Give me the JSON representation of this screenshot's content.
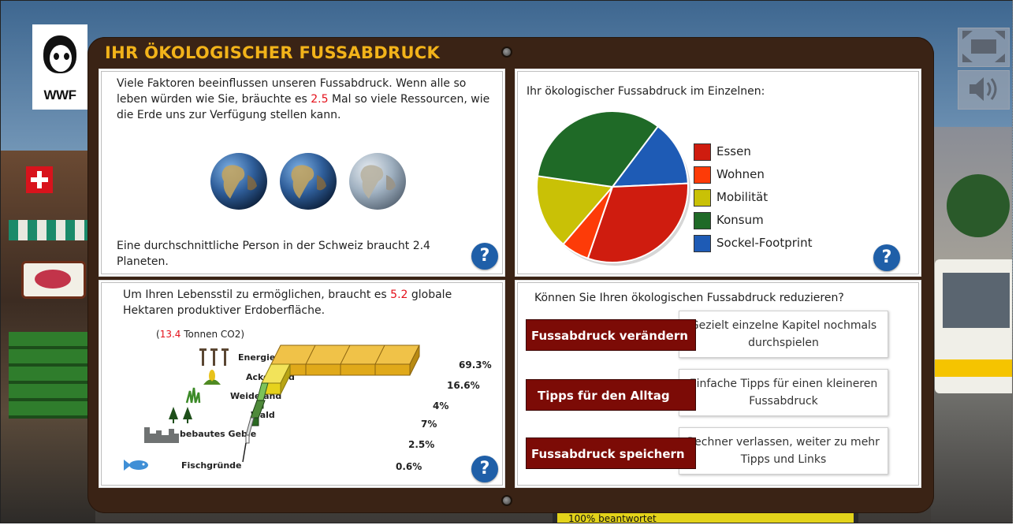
{
  "app": {
    "title": "IHR ÖKOLOGISCHER FUSSABDRUCK",
    "logo_text": "WWF",
    "accent_color": "#f2b31a",
    "board_color": "#3a2315"
  },
  "controls": {
    "fullscreen_icon": "fullscreen-icon",
    "sound_icon": "speaker-icon"
  },
  "progress": {
    "label": "100% beantwortet",
    "value": 1.0,
    "fill_color": "#e3d31a"
  },
  "panel_planets": {
    "text_before": "Viele Faktoren beeinflussen unseren Fussabdruck. Wenn alle so leben würden wie Sie, bräuchte es ",
    "value": "2.5",
    "text_after": " Mal so viele Ressourcen, wie die Erde uns zur Verfügung stellen kann.",
    "globes": [
      1,
      1,
      0.5
    ],
    "average_text": "Eine durchschnittliche Person in der Schweiz braucht 2.4 Planeten.",
    "help": "?"
  },
  "panel_pie": {
    "heading": "Ihr ökologischer Fussabdruck im Einzelnen:",
    "help": "?"
  },
  "chart_data": {
    "type": "pie",
    "series": [
      {
        "name": "Essen",
        "value": 31,
        "color": "#cf1c0f"
      },
      {
        "name": "Wohnen",
        "value": 6,
        "color": "#fd3b08"
      },
      {
        "name": "Mobilität",
        "value": 16,
        "color": "#c9c106"
      },
      {
        "name": "Konsum",
        "value": 33,
        "color": "#1f6a27"
      },
      {
        "name": "Sockel-Footprint",
        "value": 14,
        "color": "#1e5bb5"
      }
    ],
    "legend_position": "right"
  },
  "panel_hectares": {
    "text_before": "Um Ihren Lebensstil zu ermöglichen, braucht es ",
    "value": "5.2",
    "text_after": " globale Hektaren produktiver Erdoberfläche.",
    "co2_open": "(",
    "co2_value": "13.4",
    "co2_rest": " Tonnen CO2)",
    "categories": [
      {
        "label": "Energiefläche",
        "percent": "69.3%",
        "share": 69.3,
        "color": "#e0a91a"
      },
      {
        "label": "Ackerland",
        "percent": "16.6%",
        "share": 16.6,
        "color": "#e6d21c"
      },
      {
        "label": "Weideland",
        "percent": "4%",
        "share": 4,
        "color": "#4f9e3a"
      },
      {
        "label": "Wald",
        "percent": "7%",
        "share": 7,
        "color": "#2a6a22"
      },
      {
        "label": "bebautes Gebie",
        "percent": "2.5%",
        "share": 2.5,
        "color": "#9aa0a0"
      },
      {
        "label": "Fischgründe",
        "percent": "0.6%",
        "share": 0.6,
        "color": "#7aa9d8"
      }
    ],
    "help": "?"
  },
  "panel_reduce": {
    "heading": "Können Sie Ihren ökologischen Fussabdruck reduzieren?",
    "actions": [
      {
        "button": "Fussabdruck verändern",
        "desc": "Gezielt einzelne Kapitel nochmals durchspielen"
      },
      {
        "button": "Tipps für den Alltag",
        "desc": "Einfache Tipps für einen kleineren Fussabdruck"
      },
      {
        "button": "Fussabdruck speichern",
        "desc": "Rechner verlassen, weiter zu mehr Tipps und Links"
      }
    ]
  }
}
